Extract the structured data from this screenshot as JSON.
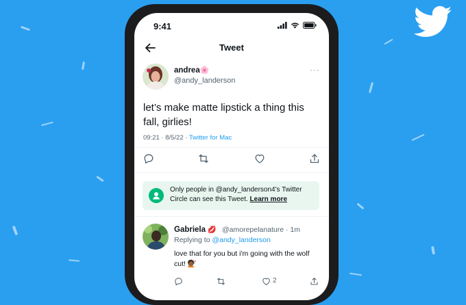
{
  "colors": {
    "background": "#2a9ff0",
    "accent": "#1d9bf0",
    "circle_green": "#00ba7c"
  },
  "status_bar": {
    "time": "9:41"
  },
  "header": {
    "title": "Tweet",
    "back_icon": "back-arrow-icon"
  },
  "tweet": {
    "author_name": "andrea",
    "author_handle": "@andy_landerson",
    "text": "let’s make matte lipstick a thing this fall, girlies!",
    "timestamp": "09:21 · 8/5/22 · ",
    "source": "Twitter for Mac",
    "actions": [
      "reply-icon",
      "retweet-icon",
      "like-icon",
      "share-icon"
    ]
  },
  "circle_notice": {
    "text": "Only people in @andy_landerson4's Twitter Circle can see this Tweet.",
    "link": "Learn more"
  },
  "reply": {
    "author_name": "Gabriela",
    "author_handle": "@amorepelanature · 1m",
    "replying_to_label": "Replying to ",
    "replying_to_handle": "@andy_landerson",
    "text": "love that for you but i'm going with the wolf cut! 💇🏾",
    "like_count": "2"
  }
}
